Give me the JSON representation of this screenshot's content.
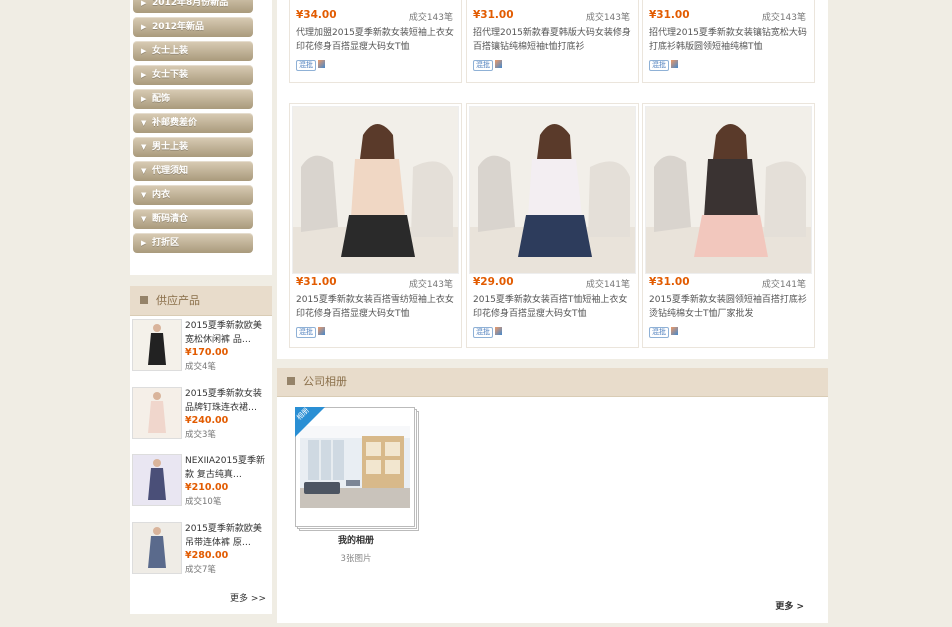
{
  "sidebar": {
    "categories": [
      {
        "label": "2012年8月份新品",
        "expanded": false
      },
      {
        "label": "2012年新品",
        "expanded": false
      },
      {
        "label": "女士上装",
        "expanded": false
      },
      {
        "label": "女士下装",
        "expanded": false
      },
      {
        "label": "配饰",
        "expanded": false
      },
      {
        "label": "补邮费差价",
        "expanded": true
      },
      {
        "label": "男士上装",
        "expanded": true
      },
      {
        "label": "代理须知",
        "expanded": true
      },
      {
        "label": "内衣",
        "expanded": true
      },
      {
        "label": "断码清仓",
        "expanded": true
      },
      {
        "label": "打折区",
        "expanded": false
      }
    ],
    "supply": {
      "title": "供应产品",
      "items": [
        {
          "title": "2015夏季新款欧美宽松休闲裤 品…",
          "price": "¥170.00",
          "sold": "成交4笔"
        },
        {
          "title": "2015夏季新款女装品牌钉珠连衣裙…",
          "price": "¥240.00",
          "sold": "成交3笔"
        },
        {
          "title": "NEXIIA2015夏季新款 复古纯真…",
          "price": "¥210.00",
          "sold": "成交10笔"
        },
        {
          "title": "2015夏季新款欧美吊带连体裤 原…",
          "price": "¥280.00",
          "sold": "成交7笔"
        }
      ],
      "more": "更多 >>"
    }
  },
  "products_top": [
    {
      "price": "¥34.00",
      "sold": "成交143笔",
      "title": "代理加盟2015夏季新款女装短袖上衣女印花修身百搭显瘦大码女T恤",
      "tag": "混批"
    },
    {
      "price": "¥31.00",
      "sold": "成交143笔",
      "title": "招代理2015新款春夏韩版大码女装修身百搭镶钻纯棉短袖t恤打底衫",
      "tag": "混批"
    },
    {
      "price": "¥31.00",
      "sold": "成交143笔",
      "title": "招代理2015夏季新款女装镶钻宽松大码打底衫韩版圆领短袖纯棉T恤",
      "tag": "混批"
    }
  ],
  "products": [
    {
      "price": "¥31.00",
      "sold": "成交143笔",
      "title": "2015夏季新款女装百搭雪纺短袖上衣女 印花修身百搭显瘦大码女T恤",
      "tag": "混批"
    },
    {
      "price": "¥29.00",
      "sold": "成交141笔",
      "title": "2015夏季新款女装百搭T恤短袖上衣女 印花修身百搭显瘦大码女T恤",
      "tag": "混批"
    },
    {
      "price": "¥31.00",
      "sold": "成交141笔",
      "title": "2015夏季新款女装圆领短袖百搭打底衫烫钻纯棉女士T恤厂家批发",
      "tag": "混批"
    }
  ],
  "album": {
    "title": "公司相册",
    "badge": "相册",
    "name": "我的相册",
    "count": "3张图片",
    "more": "更多 >"
  },
  "colors": {
    "accent": "#e25b00",
    "header_bg": "#e8dccb",
    "page_bg": "#f0ede4"
  }
}
